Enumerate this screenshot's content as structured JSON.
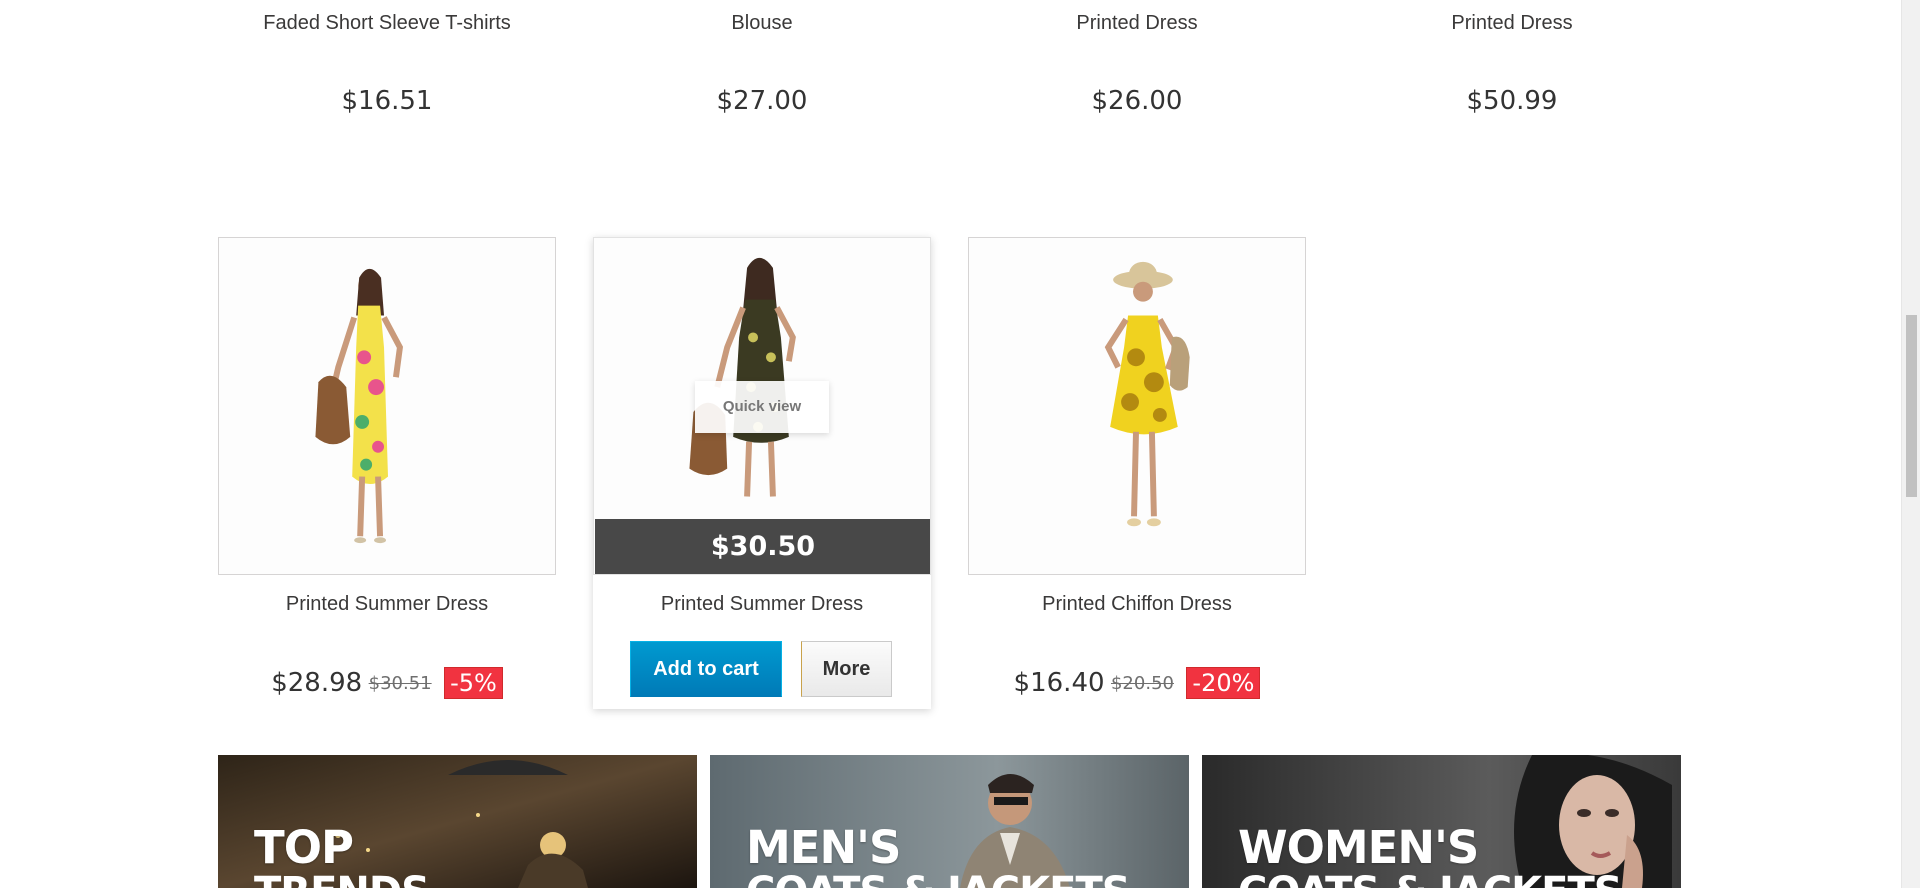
{
  "top_products": [
    {
      "name": "Faded Short Sleeve T-shirts",
      "price": "$16.51"
    },
    {
      "name": "Blouse",
      "price": "$27.00"
    },
    {
      "name": "Printed Dress",
      "price": "$26.00"
    },
    {
      "name": "Printed Dress",
      "price": "$50.99"
    }
  ],
  "products": [
    {
      "name": "Printed Summer Dress",
      "price": "$28.98",
      "old_price": "$30.51",
      "discount": "-5%",
      "dress_color": "#f3e14a",
      "pattern_color": "#e8548c"
    },
    {
      "name": "Printed Summer Dress",
      "price": "$30.50",
      "quick_view": "Quick view",
      "add_to_cart": "Add to cart",
      "more": "More",
      "dress_color": "#3b3a22",
      "pattern_color": "#c7c05a"
    },
    {
      "name": "Printed Chiffon Dress",
      "price": "$16.40",
      "old_price": "$20.50",
      "discount": "-20%",
      "dress_color": "#f0d21f",
      "pattern_color": "#b38a10"
    }
  ],
  "banners": [
    {
      "title": "TOP",
      "subtitle": "TRENDS"
    },
    {
      "title": "MEN'S",
      "subtitle": "COATS & JACKETS"
    },
    {
      "title": "WOMEN'S",
      "subtitle": "COATS & JACKETS"
    }
  ],
  "colors": {
    "price_bar": "#484848",
    "discount_badge": "#f13340",
    "add_to_cart": "#0a8fc7"
  }
}
